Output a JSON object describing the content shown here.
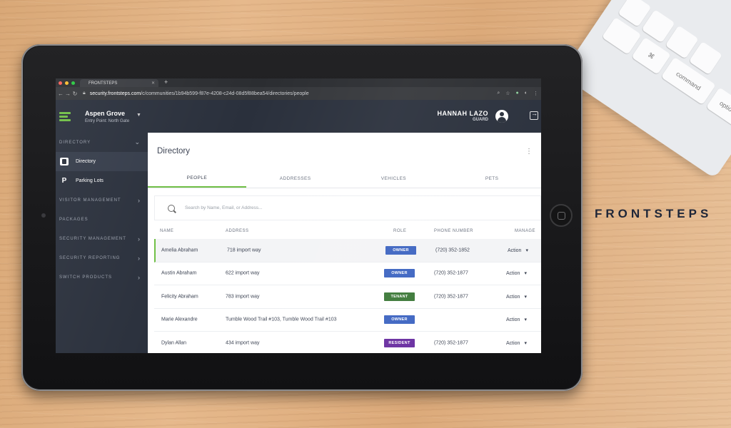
{
  "browser": {
    "tab_title": "FRONTSTEPS",
    "url_host": "security.frontsteps.com",
    "url_path": "/c/communities/1b94b599-f87e-4208-c24d-08d5f88bea54/directories/people"
  },
  "header": {
    "community": "Aspen Grove",
    "entry_point": "Entry Point: North Gate",
    "user_name": "HANNAH LAZO",
    "user_role": "GUARD"
  },
  "sidebar": {
    "sections": [
      {
        "label": "DIRECTORY"
      },
      {
        "label": "VISITOR MANAGEMENT"
      },
      {
        "label": "PACKAGES"
      },
      {
        "label": "SECURITY MANAGEMENT"
      },
      {
        "label": "SECURITY REPORTING"
      },
      {
        "label": "SWITCH PRODUCTS"
      }
    ],
    "items": [
      {
        "label": "Directory",
        "icon": "id-card-icon"
      },
      {
        "label": "Parking Lots",
        "icon": "parking-icon",
        "glyph": "P"
      }
    ]
  },
  "main": {
    "title": "Directory",
    "tabs": [
      "PEOPLE",
      "ADDRESSES",
      "VEHICLES",
      "PETS"
    ],
    "search_placeholder": "Search by Name, Email, or Address...",
    "columns": [
      "NAME",
      "ADDRESS",
      "ROLE",
      "PHONE NUMBER",
      "MANAGE"
    ],
    "rows": [
      {
        "name": "Amelia Abraham",
        "address": "718 import way",
        "role": "OWNER",
        "phone": "(720) 352-1852",
        "action": "Action"
      },
      {
        "name": "Austin Abraham",
        "address": "622 import way",
        "role": "OWNER",
        "phone": "(720) 352-1877",
        "action": "Action"
      },
      {
        "name": "Felicity Abraham",
        "address": "783 import way",
        "role": "TENANT",
        "phone": "(720) 352-1877",
        "action": "Action"
      },
      {
        "name": "Marie Alexandre",
        "address": "Tumble Wood Trail #103, Tumble Wood Trail #103",
        "role": "OWNER",
        "phone": "",
        "action": "Action"
      },
      {
        "name": "Dylan Allan",
        "address": "434 import way",
        "role": "RESIDENT",
        "phone": "(720) 352-1877",
        "action": "Action"
      }
    ]
  },
  "colors": {
    "owner": "#3f66c2",
    "tenant": "#3e7a3a",
    "resident": "#6a2fa1",
    "accent": "#6fbf45"
  },
  "brand": "FRONTSTEPS",
  "keyboard": {
    "keys": [
      "command",
      "option",
      "⌘"
    ]
  }
}
